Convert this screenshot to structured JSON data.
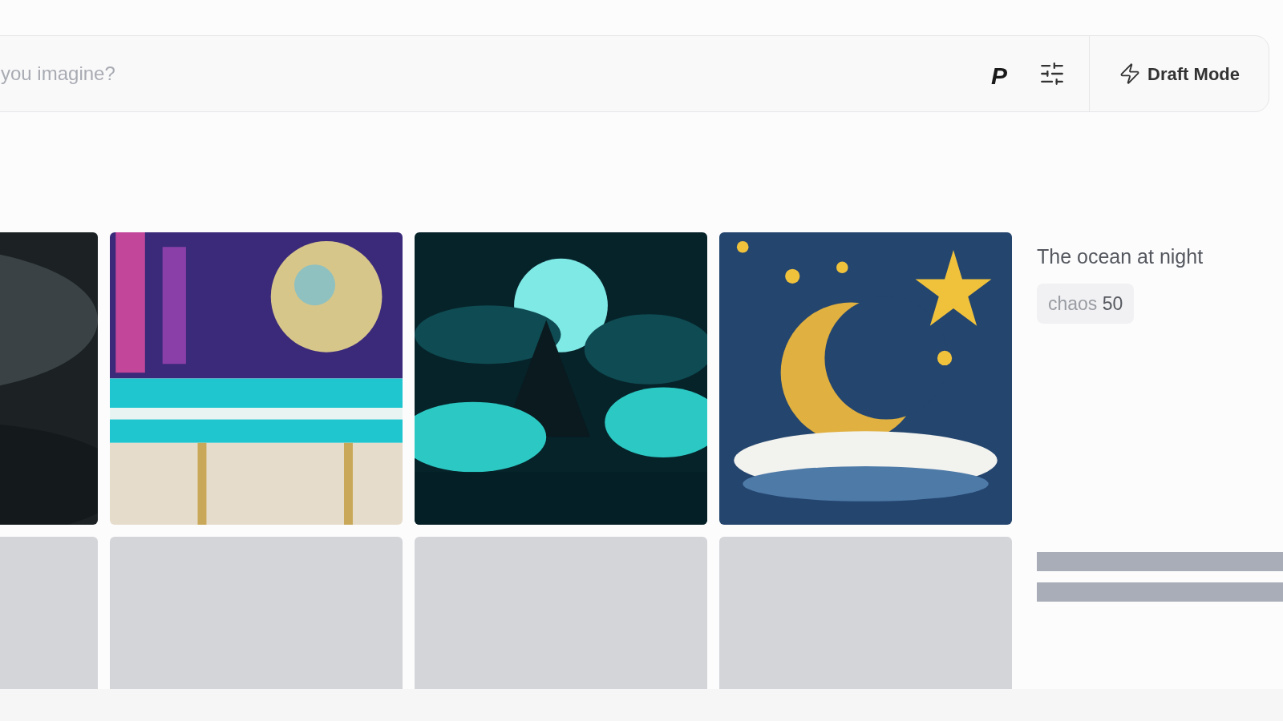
{
  "prompt_bar": {
    "placeholder": "you imagine?",
    "personalize_button": "P",
    "draft_mode_button": "Draft Mode"
  },
  "image_grid": {
    "rows": [
      {
        "tiles": [
          {
            "kind": "picture"
          },
          {
            "kind": "picture"
          },
          {
            "kind": "picture"
          },
          {
            "kind": "picture"
          }
        ]
      },
      {
        "tiles": [
          {
            "kind": "placeholder"
          },
          {
            "kind": "placeholder"
          },
          {
            "kind": "placeholder"
          },
          {
            "kind": "placeholder"
          }
        ]
      }
    ]
  },
  "details": {
    "prompt": "The ocean at night",
    "params": [
      {
        "name": "chaos",
        "value": "50"
      }
    ],
    "skeleton_lines": [
      {
        "kind": "bar"
      },
      {
        "kind": "bar"
      }
    ]
  }
}
